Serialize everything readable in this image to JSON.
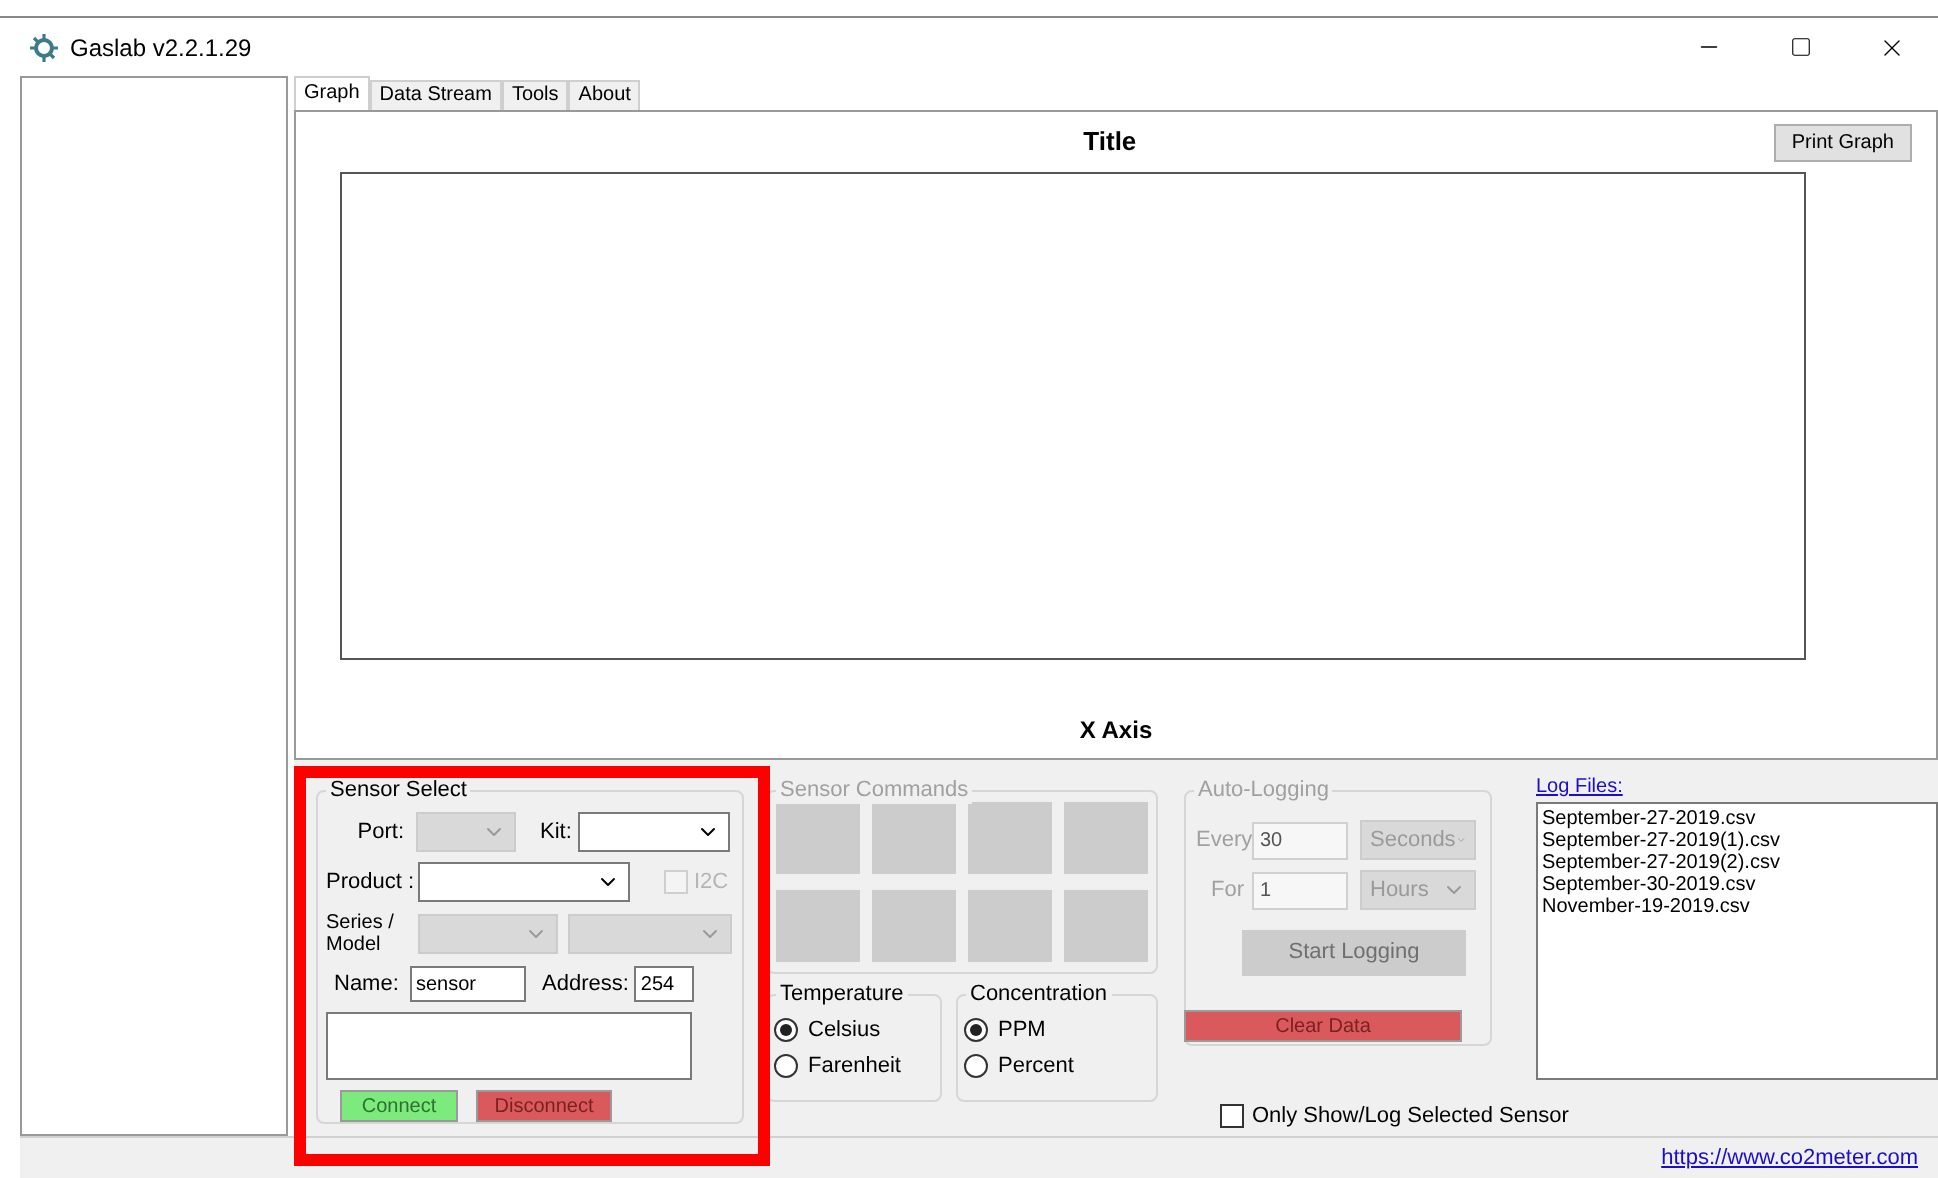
{
  "window": {
    "title": "Gaslab v2.2.1.29"
  },
  "tabs": [
    {
      "label": "Graph",
      "selected": true
    },
    {
      "label": "Data Stream",
      "selected": false
    },
    {
      "label": "Tools",
      "selected": false
    },
    {
      "label": "About",
      "selected": false
    }
  ],
  "graph": {
    "title": "Title",
    "x_axis_label": "X Axis",
    "print_button": "Print Graph"
  },
  "sensor_select": {
    "title": "Sensor Select",
    "highlighted": true,
    "port": {
      "label": "Port:",
      "disabled": true
    },
    "kit": {
      "label": "Kit:",
      "disabled": false
    },
    "product": {
      "label": "Product :",
      "disabled": false
    },
    "i2c": {
      "label": "I2C",
      "checked": false,
      "disabled": true
    },
    "series_model": {
      "label": "Series / Model",
      "disabled": true
    },
    "model": {
      "disabled": true
    },
    "name": {
      "label": "Name:",
      "value": "sensor"
    },
    "address": {
      "label": "Address:",
      "value": "254"
    },
    "connect_button": "Connect",
    "disconnect_button": "Disconnect"
  },
  "sensor_commands": {
    "title": "Sensor Commands",
    "disabled": true,
    "buttons": [
      {
        "disabled": true
      },
      {
        "disabled": true
      },
      {
        "disabled": true
      },
      {
        "disabled": true
      },
      {
        "disabled": true
      },
      {
        "disabled": true
      },
      {
        "disabled": true
      },
      {
        "disabled": true
      }
    ]
  },
  "temperature": {
    "title": "Temperature",
    "options": [
      {
        "label": "Celsius",
        "selected": true
      },
      {
        "label": "Farenheit",
        "selected": false
      }
    ]
  },
  "concentration": {
    "title": "Concentration",
    "options": [
      {
        "label": "PPM",
        "selected": true
      },
      {
        "label": "Percent",
        "selected": false
      }
    ]
  },
  "auto_logging": {
    "title": "Auto-Logging",
    "disabled": true,
    "every": {
      "label": "Every",
      "value": "30",
      "unit": "Seconds"
    },
    "for": {
      "label": "For",
      "value": "1",
      "unit": "Hours"
    },
    "start_button": "Start Logging"
  },
  "clear_button": "Clear Data",
  "only_selected": {
    "label": "Only Show/Log Selected Sensor",
    "checked": false
  },
  "log_files": {
    "title": "Log Files:",
    "items": [
      "September-27-2019.csv",
      "September-27-2019(1).csv",
      "September-27-2019(2).csv",
      "September-30-2019.csv",
      "November-19-2019.csv"
    ]
  },
  "status_bar": {
    "link": "https://www.co2meter.com"
  }
}
